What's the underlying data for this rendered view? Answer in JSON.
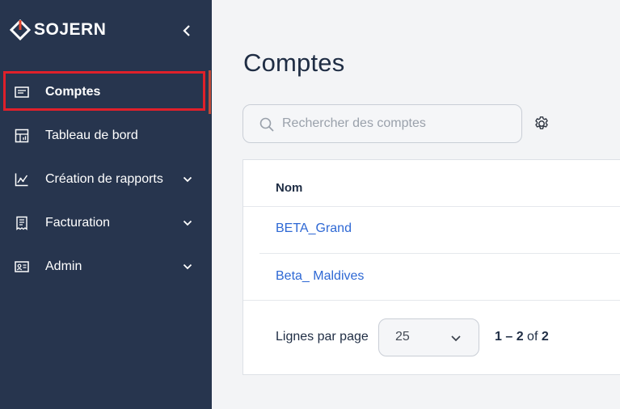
{
  "brand": {
    "name": "SOJERN"
  },
  "sidebar": {
    "items": [
      {
        "label": "Comptes",
        "icon": "list-card-icon",
        "has_chevron": false,
        "active": true
      },
      {
        "label": "Tableau de bord",
        "icon": "dashboard-icon",
        "has_chevron": true,
        "active": false
      },
      {
        "label": "Création de rapports",
        "icon": "chart-line-icon",
        "has_chevron": true,
        "active": false
      },
      {
        "label": "Facturation",
        "icon": "receipt-icon",
        "has_chevron": true,
        "active": false
      },
      {
        "label": "Admin",
        "icon": "id-card-icon",
        "has_chevron": true,
        "active": false
      }
    ]
  },
  "main": {
    "title": "Comptes",
    "search": {
      "placeholder": "Rechercher des comptes",
      "value": ""
    },
    "table": {
      "column_header": "Nom",
      "rows": [
        "BETA_Grand",
        "Beta_ Maldives"
      ]
    },
    "pagination": {
      "rows_per_page_label": "Lignes par page",
      "rows_per_page_value": "25",
      "range_start": "1",
      "range_sep": " – ",
      "range_end": "2",
      "of_label": " of ",
      "total": "2"
    }
  },
  "colors": {
    "sidebar_bg": "#27354e",
    "accent": "#c24a38",
    "link": "#2e68d4",
    "highlight": "#e0202a"
  }
}
